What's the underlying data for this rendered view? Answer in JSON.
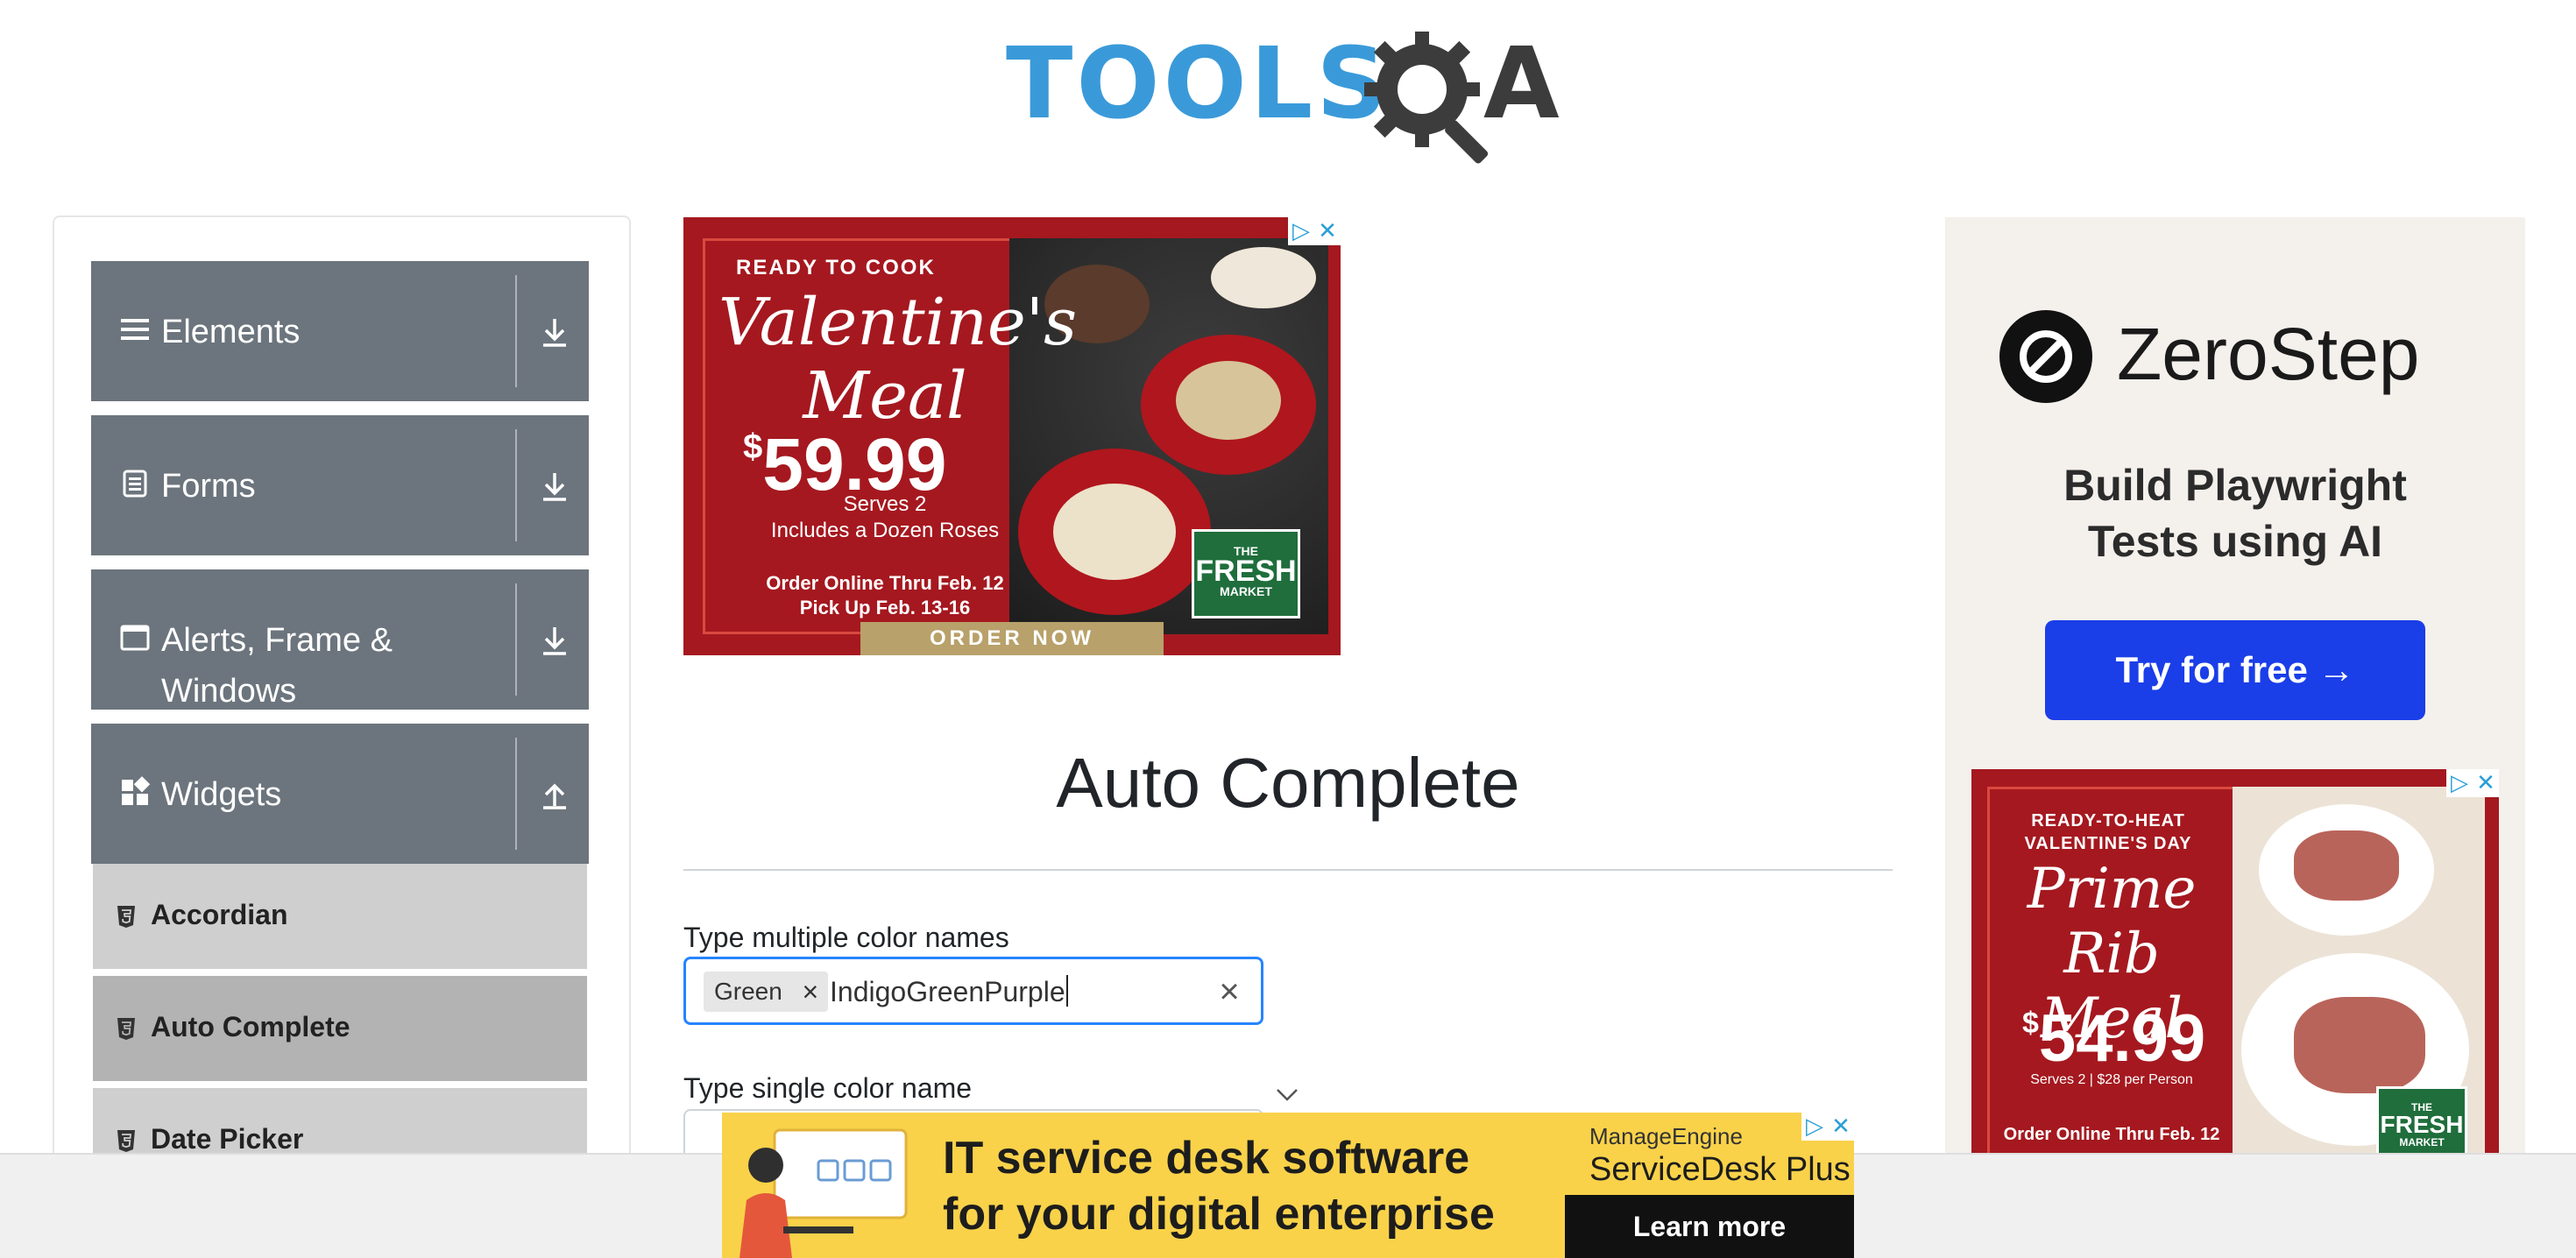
{
  "header": {
    "logo_text_tools": "TOOLS",
    "logo_text_a": "A"
  },
  "sidebar": {
    "groups": [
      {
        "label": "Elements",
        "icon": "hamburger-icon",
        "arrow": "download-arrow-icon"
      },
      {
        "label": "Forms",
        "icon": "document-icon",
        "arrow": "download-arrow-icon"
      },
      {
        "label": "Alerts, Frame & Windows",
        "icon": "window-icon",
        "arrow": "download-arrow-icon"
      },
      {
        "label": "Widgets",
        "icon": "widgets-icon",
        "arrow": "upload-arrow-icon"
      }
    ],
    "items": [
      {
        "label": "Accordian",
        "active": false
      },
      {
        "label": "Auto Complete",
        "active": true
      },
      {
        "label": "Date Picker",
        "active": false
      }
    ]
  },
  "ads": {
    "valentine": {
      "eyebrow": "READY TO COOK",
      "title": "Valentine's Meal",
      "price_symbol": "$",
      "price": "59.99",
      "serves": "Serves 2",
      "roses": "Includes a Dozen Roses",
      "order_line1": "Order Online Thru Feb. 12",
      "order_line2": "Pick Up Feb. 13-16",
      "badge_small": "THE",
      "badge_big": "FRESH",
      "badge_small2": "MARKET",
      "cta": "ORDER NOW"
    },
    "zerostep": {
      "name": "ZeroStep",
      "tagline_1": "Build Playwright",
      "tagline_2": "Tests using AI",
      "button": "Try for free →"
    },
    "primerib": {
      "eyebrow_1": "READY-TO-HEAT",
      "eyebrow_2": "VALENTINE'S DAY",
      "title": "Prime Rib Meal",
      "price_symbol": "$",
      "price": "54.99",
      "serves": "Serves 2 | $28 per Person",
      "order": "Order Online Thru Feb. 12",
      "badge_small": "THE",
      "badge_big": "FRESH",
      "badge_small2": "MARKET"
    },
    "bottom": {
      "headline_1": "IT service desk software",
      "headline_2": "for your digital enterprise",
      "brand_small": "ManageEngine",
      "brand": "ServiceDesk Plus",
      "cta": "Learn more"
    },
    "close_glyph_1": "▷",
    "close_glyph_2": "✕"
  },
  "main": {
    "title": "Auto Complete",
    "multi": {
      "label": "Type multiple color names",
      "chips": [
        "Green"
      ],
      "chip_remove": "×",
      "typed_value": "IndigoGreenPurple",
      "clear": "×"
    },
    "single": {
      "label": "Type single color name",
      "value": ""
    }
  },
  "colors": {
    "sidebar_group_bg": "#6c757d",
    "sidebar_item_bg": "#cfcfcf",
    "sidebar_item_active_bg": "#b3b3b3",
    "focus_border": "#2684ff",
    "logo_blue": "#3a9ad9",
    "ad_red": "#a5181f",
    "zerostep_button": "#1a3ee8",
    "bottom_ad_yellow": "#f9d24a"
  }
}
